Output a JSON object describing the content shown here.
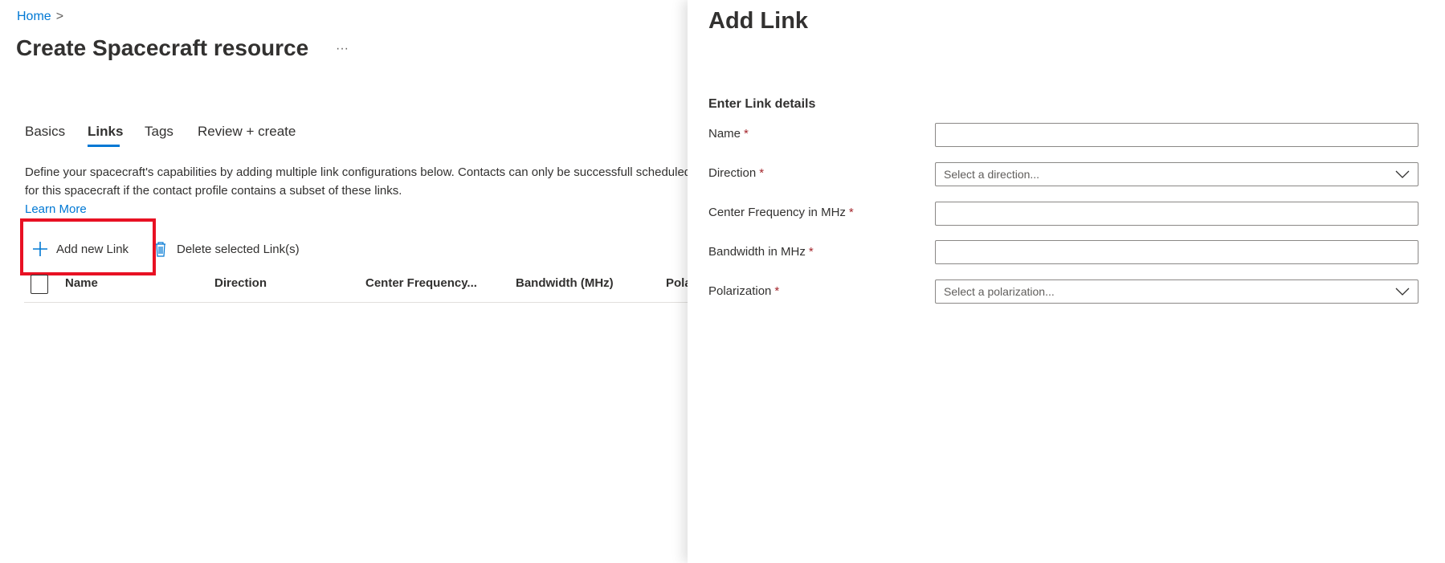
{
  "breadcrumb": {
    "home": "Home",
    "sep": ">"
  },
  "page": {
    "title": "Create Spacecraft resource",
    "more": "···"
  },
  "tabs": [
    {
      "label": "Basics"
    },
    {
      "label": "Links"
    },
    {
      "label": "Tags"
    },
    {
      "label": "Review + create"
    }
  ],
  "description": "Define your spacecraft's capabilities by adding multiple link configurations below. Contacts can only be successfull scheduled for this spacecraft if the contact profile contains a subset of these links.",
  "learn_more": "Learn More",
  "toolbar": {
    "add": "Add new Link",
    "delete": "Delete selected Link(s)"
  },
  "table": {
    "columns": [
      "Name",
      "Direction",
      "Center Frequency...",
      "Bandwidth (MHz)",
      "Pola"
    ]
  },
  "panel": {
    "title": "Add Link",
    "section": "Enter Link details",
    "required_mark": "*",
    "fields": [
      {
        "label": "Name",
        "value": ""
      },
      {
        "label": "Direction",
        "placeholder": "Select a direction..."
      },
      {
        "label": "Center Frequency in MHz",
        "value": ""
      },
      {
        "label": "Bandwidth in MHz",
        "value": ""
      },
      {
        "label": "Polarization",
        "placeholder": "Select a polarization..."
      }
    ]
  }
}
